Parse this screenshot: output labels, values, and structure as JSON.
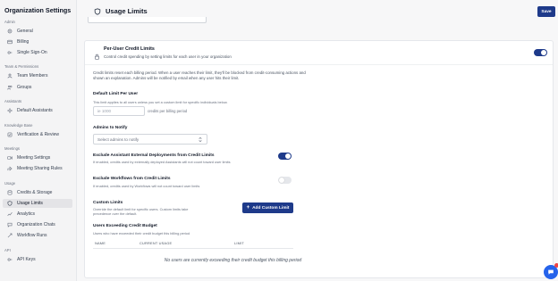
{
  "sidebar": {
    "title": "Organization Settings",
    "sections": [
      {
        "label": "Admin",
        "items": [
          {
            "label": "General",
            "icon": "gear-icon"
          },
          {
            "label": "Billing",
            "icon": "card-icon"
          },
          {
            "label": "Single Sign-On",
            "icon": "key-icon"
          }
        ]
      },
      {
        "label": "Team & Permissions",
        "items": [
          {
            "label": "Team Members",
            "icon": "user-icon"
          },
          {
            "label": "Groups",
            "icon": "users-icon"
          }
        ]
      },
      {
        "label": "Assistants",
        "items": [
          {
            "label": "Default Assistants",
            "icon": "sparkle-icon"
          }
        ]
      },
      {
        "label": "Knowledge Base",
        "items": [
          {
            "label": "Verification & Review",
            "icon": "check-badge-icon"
          }
        ]
      },
      {
        "label": "Meetings",
        "items": [
          {
            "label": "Meeting Settings",
            "icon": "video-icon"
          },
          {
            "label": "Meeting Sharing Rules",
            "icon": "share-icon"
          }
        ]
      },
      {
        "label": "Usage",
        "items": [
          {
            "label": "Credits & Storage",
            "icon": "database-icon"
          },
          {
            "label": "Usage Limits",
            "icon": "shield-icon",
            "active": true
          },
          {
            "label": "Analytics",
            "icon": "chart-icon"
          },
          {
            "label": "Organization Chats",
            "icon": "chat-icon"
          },
          {
            "label": "Workflow Runs",
            "icon": "workflow-icon"
          }
        ]
      },
      {
        "label": "API",
        "items": [
          {
            "label": "API Keys",
            "icon": "key-icon"
          }
        ]
      }
    ]
  },
  "header": {
    "title": "Usage Limits",
    "title_icon": "shield-icon",
    "save_label": "Save"
  },
  "card": {
    "title": "Per-User Credit Limits",
    "subtitle": "Control credit spending by setting limits for each user in your organization",
    "enabled": true,
    "description": "Credit limits reset each billing period. When a user reaches their limit, they'll be blocked from credit-consuming actions and shown an explanation. Admins will be notified by email when any user hits their limit.",
    "default_limit": {
      "label": "Default Limit Per User",
      "help": "This limit applies to all users unless you set a custom limit for specific individuals below.",
      "placeholder": "ie 1000",
      "suffix": "credits per billing period"
    },
    "admins_notify": {
      "label": "Admins to Notify",
      "placeholder": "Select admins to notify"
    },
    "exclude_assistant": {
      "label": "Exclude Assistant External Deployments from Credit Limits",
      "help": "If enabled, credits used by externally deployed Assistants will not count toward user limits",
      "enabled": true
    },
    "exclude_workflows": {
      "label": "Exclude Workflows from Credit Limits",
      "help": "If enabled, credits used by Workflows will not count toward user limits",
      "enabled": false
    },
    "custom_limits": {
      "label": "Custom Limits",
      "help": "Override the default limit for specific users. Custom limits take precedence over the default.",
      "add_label": "Add Custom Limit"
    },
    "exceeding": {
      "label": "Users Exceeding Credit Budget",
      "help": "Users who have exceeded their credit budget this billing period",
      "columns": [
        "NAME",
        "CURRENT USAGE",
        "LIMIT"
      ],
      "empty": "No users are currently exceeding their credit budget this billing period"
    }
  },
  "colors": {
    "accent": "#1e3a8a",
    "chat_fab": "#2563eb",
    "badge": "#ef4444"
  }
}
